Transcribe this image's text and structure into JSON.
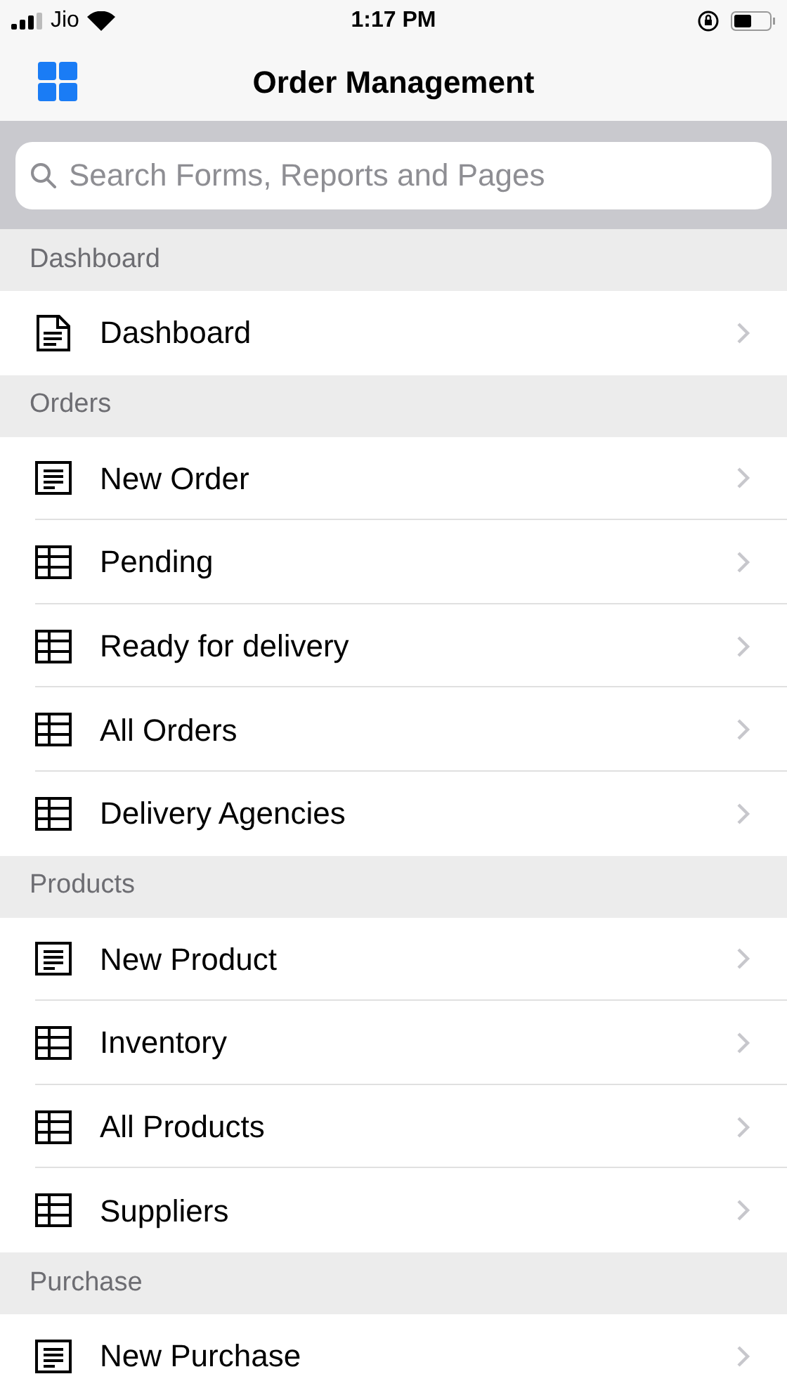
{
  "status_bar": {
    "carrier": "Jio",
    "time": "1:17 PM"
  },
  "nav": {
    "title": "Order Management"
  },
  "search": {
    "placeholder": "Search Forms, Reports and Pages"
  },
  "sections": [
    {
      "title": "Dashboard",
      "items": [
        {
          "label": "Dashboard",
          "kind": "page"
        }
      ]
    },
    {
      "title": "Orders",
      "items": [
        {
          "label": "New Order",
          "kind": "form"
        },
        {
          "label": "Pending",
          "kind": "table"
        },
        {
          "label": "Ready for delivery",
          "kind": "table"
        },
        {
          "label": "All Orders",
          "kind": "table"
        },
        {
          "label": "Delivery Agencies",
          "kind": "table"
        }
      ]
    },
    {
      "title": "Products",
      "items": [
        {
          "label": "New Product",
          "kind": "form"
        },
        {
          "label": "Inventory",
          "kind": "table"
        },
        {
          "label": "All Products",
          "kind": "table"
        },
        {
          "label": "Suppliers",
          "kind": "table"
        }
      ]
    },
    {
      "title": "Purchase",
      "items": [
        {
          "label": "New Purchase",
          "kind": "form"
        }
      ]
    }
  ]
}
